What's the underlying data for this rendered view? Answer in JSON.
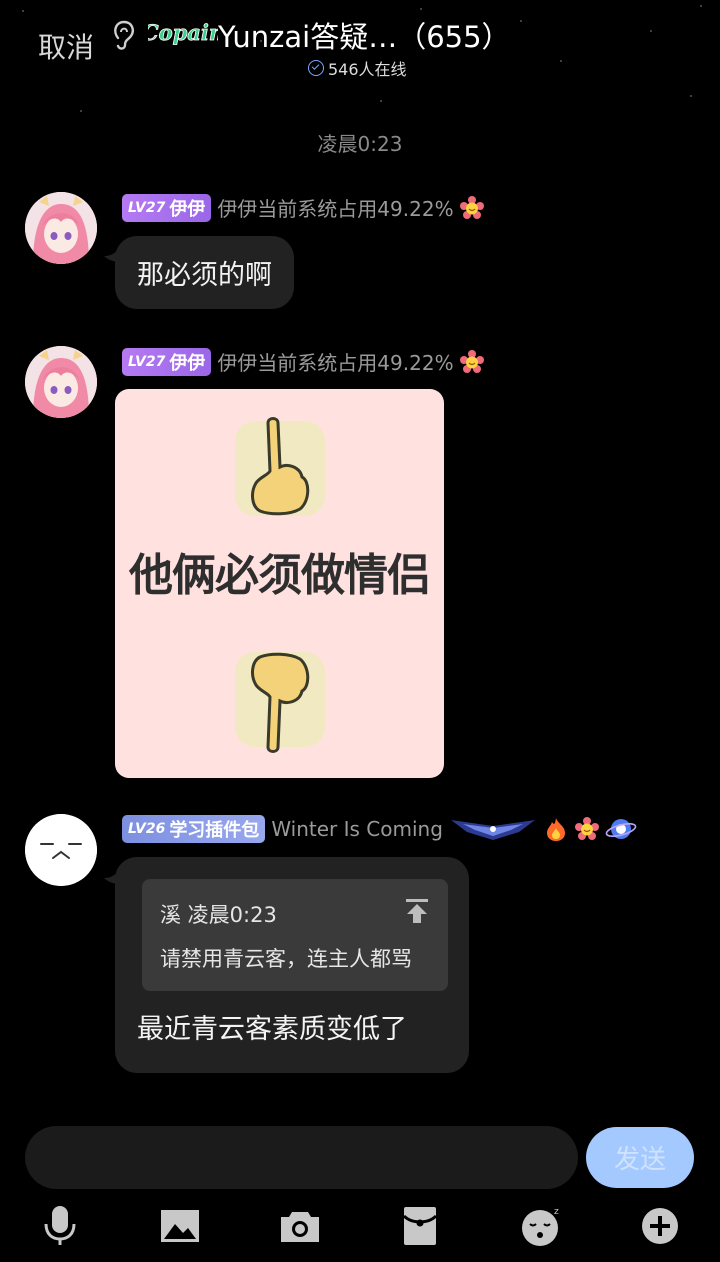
{
  "header": {
    "cancel_label": "取消",
    "logo_text": "Copain",
    "title": "Yunzai答疑…（655）",
    "online_text": "546人在线"
  },
  "time_separator": "凌晨0:23",
  "messages": [
    {
      "level": "LV27",
      "nickname": "伊伊",
      "title": "伊伊当前系统占用49.22%",
      "text": "那必须的啊"
    },
    {
      "level": "LV27",
      "nickname": "伊伊",
      "title": "伊伊当前系统占用49.22%",
      "image_text": "他俩必须做情侣"
    },
    {
      "level": "LV26",
      "nickname": "学习插件包",
      "title": "Winter Is Coming",
      "reply": {
        "header": "溪 凌晨0:23",
        "body": "请禁用青云客，连主人都骂"
      },
      "text": "最近青云客素质变低了"
    }
  ],
  "composer": {
    "input_value": "",
    "send_label": "发送"
  },
  "toolbar": [
    "mic-icon",
    "image-icon",
    "camera-icon",
    "red-packet-icon",
    "emoji-icon",
    "plus-icon"
  ],
  "colors": {
    "background": "#000000",
    "bubble": "#222222",
    "lv_purple": "#a86ff0",
    "lv_blue": "#8a9ce8",
    "send_button": "#a4c9ff"
  }
}
